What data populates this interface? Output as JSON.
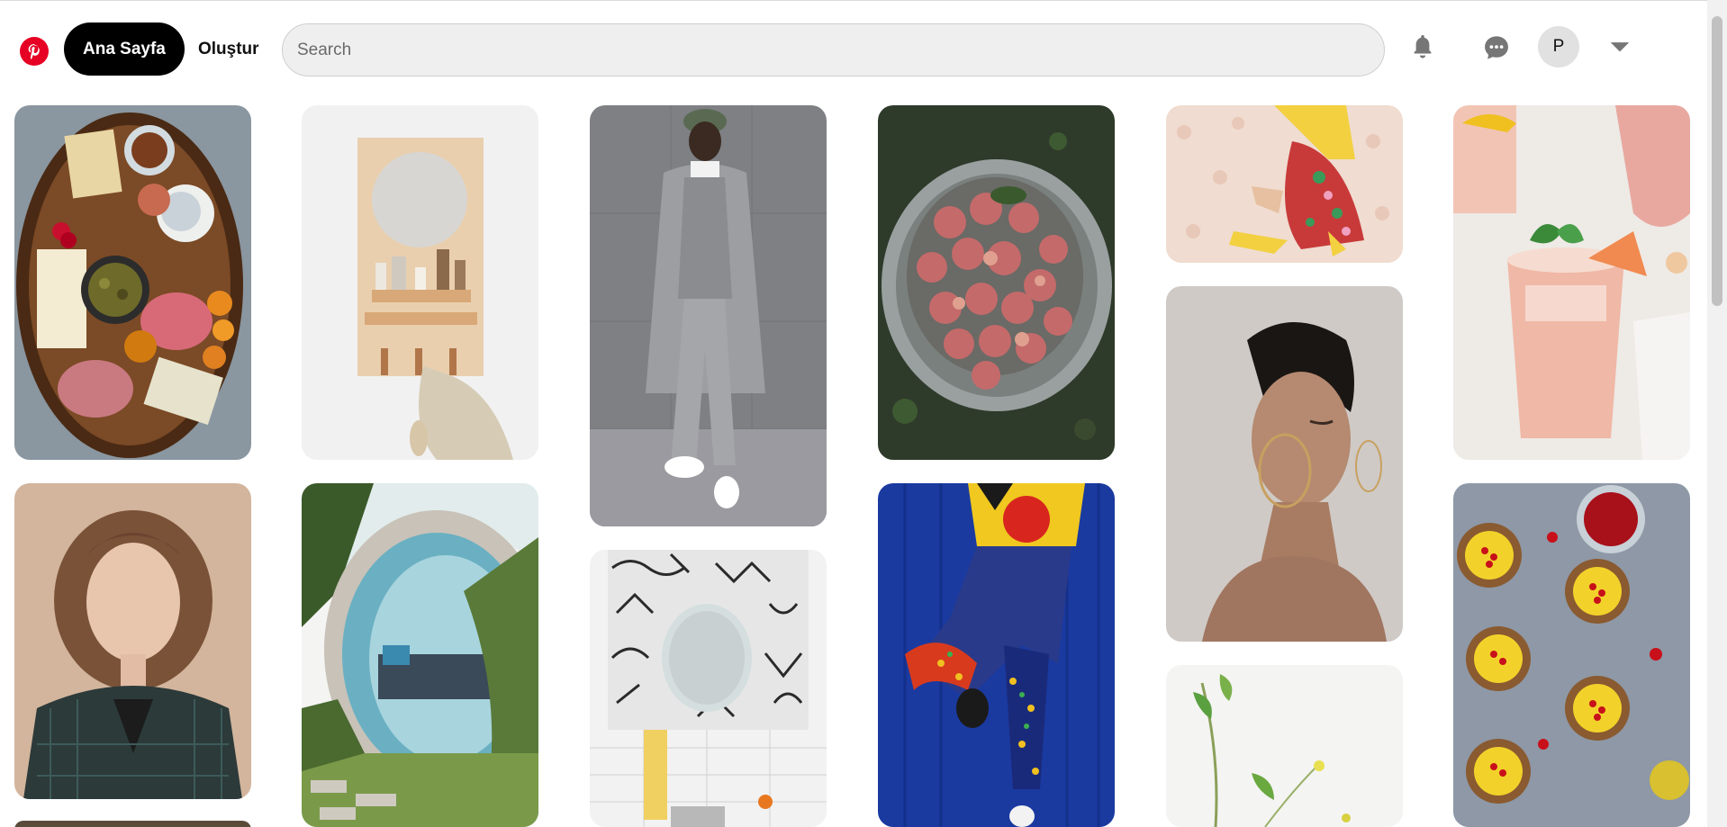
{
  "header": {
    "logo": {
      "icon": "pinterest-logo-icon",
      "color": "#e60023"
    },
    "nav": {
      "home_label": "Ana Sayfa",
      "create_label": "Oluştur"
    },
    "search": {
      "placeholder": "Search",
      "value": ""
    },
    "icons": {
      "notifications": "bell-icon",
      "messages": "chat-bubble-icon",
      "account_menu": "chevron-down-icon"
    },
    "avatar_initial": "P"
  },
  "colors": {
    "brand": "#e60023",
    "active_nav_bg": "#000000",
    "search_bg": "#efefef",
    "avatar_bg": "#e1e1e1"
  },
  "feed": {
    "pins": [
      {
        "subject": "charcuterie board"
      },
      {
        "subject": "wall mirror with shelf"
      },
      {
        "subject": "man in grey coat"
      },
      {
        "subject": "bucket of plums"
      },
      {
        "subject": "floral skirt and yellow heels"
      },
      {
        "subject": "peach drink"
      },
      {
        "subject": "woman with wavy hair"
      },
      {
        "subject": "concrete pipe garden nook"
      },
      {
        "subject": "patterned bathroom wall mirror"
      },
      {
        "subject": "colorful patterned outfit"
      },
      {
        "subject": "woman with hoop earrings"
      },
      {
        "subject": "lemon tarts with currants"
      },
      {
        "subject": "green plant sprigs"
      },
      {
        "subject": "partial pin"
      }
    ]
  }
}
